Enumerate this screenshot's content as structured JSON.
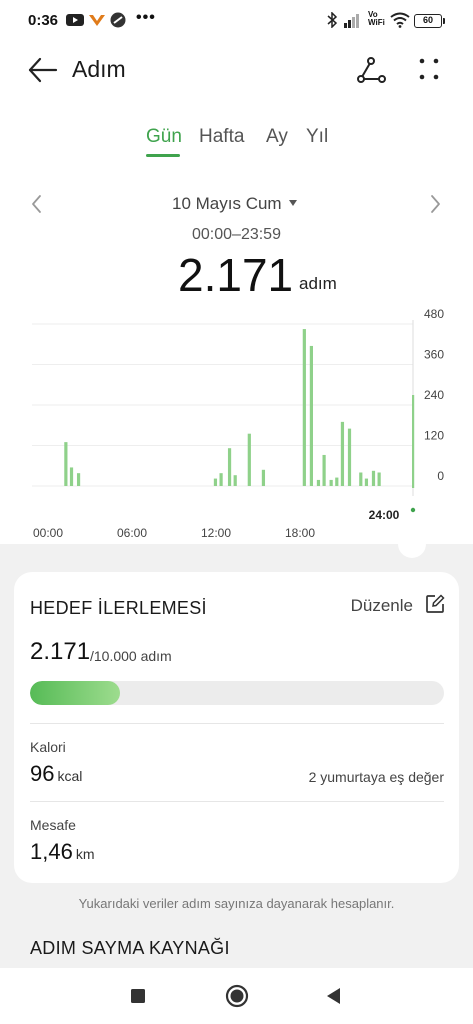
{
  "status_bar": {
    "time": "0:36",
    "vowifi": "Vo\nWiFi",
    "battery": "60",
    "more_indicator": "•••"
  },
  "header": {
    "title": "Adım",
    "back_icon": "arrow-left-icon",
    "route_icon": "route-icon",
    "more_icon": "more-dots-icon"
  },
  "tabs": [
    {
      "label": "Gün",
      "active": true
    },
    {
      "label": "Hafta",
      "active": false
    },
    {
      "label": "Ay",
      "active": false
    },
    {
      "label": "Yıl",
      "active": false
    }
  ],
  "date": {
    "label": "10 Mayıs Cum",
    "range": "00:00–23:59"
  },
  "total": {
    "value": "2.171",
    "unit": "adım"
  },
  "chart_data": {
    "type": "bar",
    "y_ticks": [
      "480",
      "360",
      "240",
      "120",
      "0"
    ],
    "ylim": [
      0,
      480
    ],
    "x_ticks": [
      "00:00",
      "06:00",
      "12:00",
      "18:00"
    ],
    "end_tick": "24:00",
    "grid": true,
    "bar_color": "#8fd18a",
    "bars": [
      {
        "x": 2.4,
        "y": 130
      },
      {
        "x": 2.8,
        "y": 55
      },
      {
        "x": 3.3,
        "y": 38
      },
      {
        "x": 13.0,
        "y": 22
      },
      {
        "x": 13.4,
        "y": 38
      },
      {
        "x": 14.0,
        "y": 112
      },
      {
        "x": 14.4,
        "y": 32
      },
      {
        "x": 15.4,
        "y": 155
      },
      {
        "x": 16.4,
        "y": 48
      },
      {
        "x": 19.3,
        "y": 465
      },
      {
        "x": 19.8,
        "y": 415
      },
      {
        "x": 20.3,
        "y": 18
      },
      {
        "x": 20.7,
        "y": 92
      },
      {
        "x": 21.2,
        "y": 18
      },
      {
        "x": 21.6,
        "y": 25
      },
      {
        "x": 22.0,
        "y": 190
      },
      {
        "x": 22.5,
        "y": 170
      },
      {
        "x": 23.3,
        "y": 40
      },
      {
        "x": 23.7,
        "y": 22
      },
      {
        "x": 24.2,
        "y": 45
      },
      {
        "x": 24.6,
        "y": 40
      }
    ]
  },
  "goal": {
    "title": "HEDEF İLERLEMESİ",
    "edit_label": "Düzenle",
    "current": "2.171",
    "target": "/10.000 adım",
    "progress": 0.217
  },
  "calories": {
    "label": "Kalori",
    "value": "96",
    "unit": "kcal",
    "equivalent": "2 yumurtaya eş değer"
  },
  "distance": {
    "label": "Mesafe",
    "value": "1,46",
    "unit": "km"
  },
  "footnote": "Yukarıdaki veriler adım sayınıza dayanarak hesaplanır.",
  "section_title": "ADIM SAYMA KAYNAĞI",
  "colors": {
    "accent": "#3fa34d",
    "bar": "#8fd18a",
    "progress_start": "#56bb56",
    "progress_end": "#9ddc8e",
    "background_grey": "#f1f1f1"
  }
}
